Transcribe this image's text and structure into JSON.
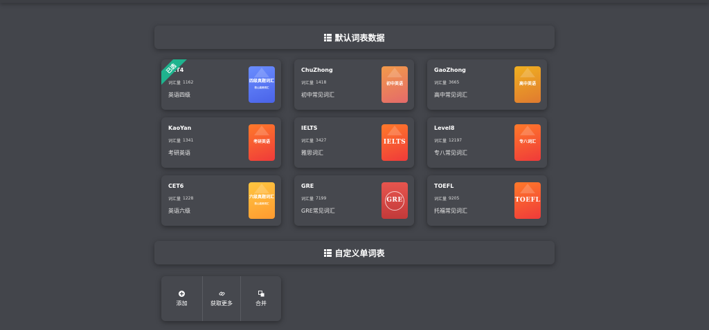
{
  "sections": {
    "default_title": "默认词表数据",
    "custom_title": "自定义单词表"
  },
  "count_label": "词汇量",
  "selected_badge": "已选",
  "wordbooks": [
    {
      "name": "CET4",
      "count": "1162",
      "desc": "英语四级",
      "cover_title": "四级真题词汇",
      "cover_sub": "核心高频词汇",
      "selected": true
    },
    {
      "name": "ChuZhong",
      "count": "1418",
      "desc": "初中常见词汇",
      "cover_title": "初中英语",
      "cover_sub": "",
      "selected": false
    },
    {
      "name": "GaoZhong",
      "count": "3665",
      "desc": "高中常见词汇",
      "cover_title": "高中英语",
      "cover_sub": "",
      "selected": false
    },
    {
      "name": "KaoYan",
      "count": "1341",
      "desc": "考研英语",
      "cover_title": "考研英语",
      "cover_sub": "",
      "selected": false
    },
    {
      "name": "IELTS",
      "count": "3427",
      "desc": "雅思词汇",
      "cover_title": "IELTS",
      "cover_sub": "",
      "selected": false
    },
    {
      "name": "Level8",
      "count": "12197",
      "desc": "专八常见词汇",
      "cover_title": "专八词汇",
      "cover_sub": "",
      "selected": false
    },
    {
      "name": "CET6",
      "count": "1228",
      "desc": "英语六级",
      "cover_title": "六级真题词汇",
      "cover_sub": "核心高频词汇",
      "selected": false
    },
    {
      "name": "GRE",
      "count": "7199",
      "desc": "GRE常见词汇",
      "cover_title": "GRE",
      "cover_sub": "",
      "selected": false
    },
    {
      "name": "TOEFL",
      "count": "9205",
      "desc": "托福常见词汇",
      "cover_title": "TOEFL",
      "cover_sub": "",
      "selected": false
    }
  ],
  "actions": {
    "add": "添加",
    "more": "获取更多",
    "merge": "合并"
  },
  "icons": {
    "section": "grid-list-icon",
    "count": "book-icon",
    "add": "plus-circle-icon",
    "more": "link-icon",
    "merge": "merge-icon"
  },
  "colors": {
    "background": "#43454b",
    "panel": "#46484e",
    "ribbon": "#1fb38e"
  }
}
